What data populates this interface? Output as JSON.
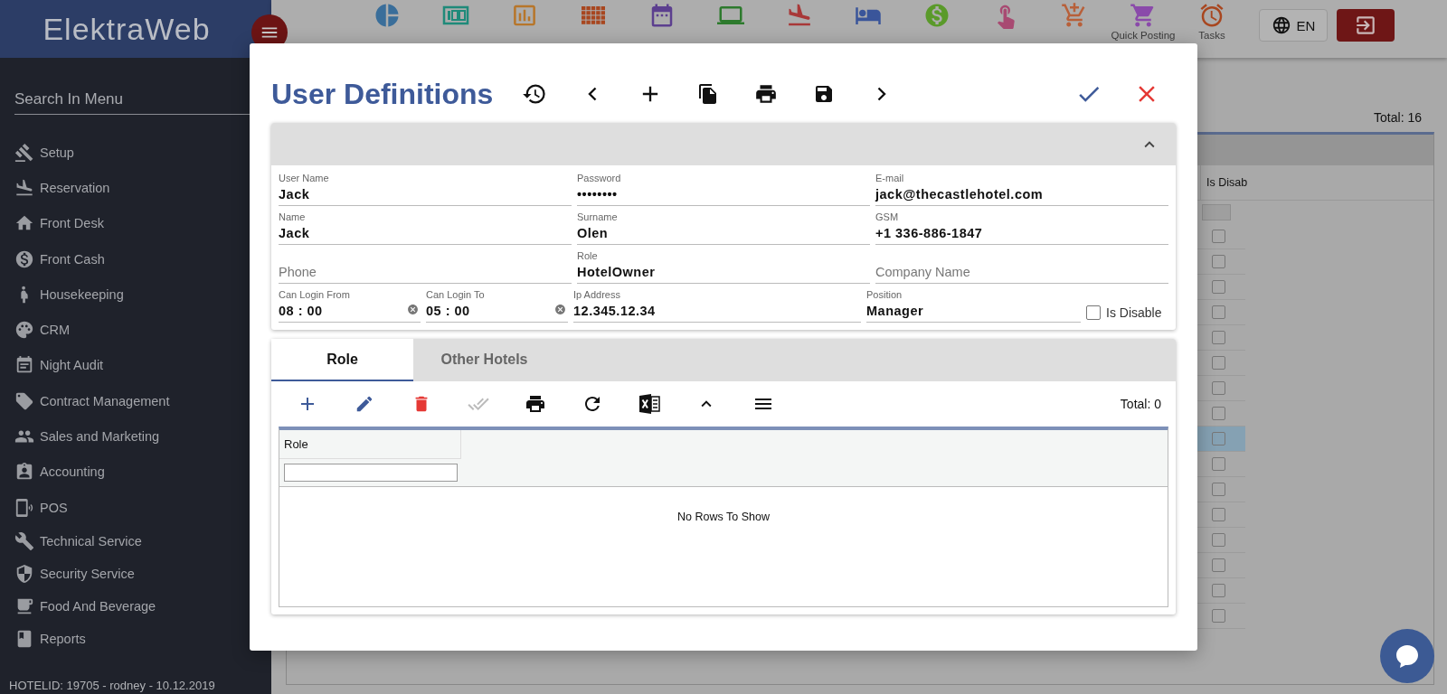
{
  "header": {
    "brand": "ElektraWeb",
    "toolbar": [
      {
        "kind": "pie",
        "color": "#3a6e9a"
      },
      {
        "kind": "hundred",
        "color": "#1f8a7a"
      },
      {
        "kind": "chart",
        "color": "#b7762a"
      },
      {
        "kind": "rack",
        "color": "#a8461f"
      },
      {
        "kind": "calendar",
        "color": "#5c3f8f"
      },
      {
        "kind": "laptop",
        "color": "#2d7a2d"
      },
      {
        "kind": "landing",
        "color": "#a83838"
      },
      {
        "kind": "bed",
        "color": "#3a559a"
      },
      {
        "kind": "cash",
        "color": "#5a9a2a"
      },
      {
        "kind": "touch",
        "color": "#a84a72"
      },
      {
        "kind": "cart-plus",
        "color": "#b8603a"
      },
      {
        "kind": "cart",
        "label": "Quick Posting",
        "color": "#8a4aaa"
      },
      {
        "kind": "alarm",
        "label": "Tasks",
        "color": "#a8461f"
      }
    ],
    "language": "EN"
  },
  "sidebar": {
    "search": {
      "placeholder": "Search In Menu"
    },
    "items": [
      {
        "kind": "gavel",
        "label": "Setup"
      },
      {
        "kind": "landing",
        "label": "Reservation"
      },
      {
        "kind": "home",
        "label": "Front Desk"
      },
      {
        "kind": "cash",
        "label": "Front Cash"
      },
      {
        "kind": "person",
        "label": "Housekeeping"
      },
      {
        "kind": "palette",
        "label": "CRM"
      },
      {
        "kind": "calendar",
        "label": "Night Audit"
      },
      {
        "kind": "tag",
        "label": "Contract Management"
      },
      {
        "kind": "people",
        "label": "Sales and Marketing"
      },
      {
        "kind": "badge",
        "label": "Accounting"
      },
      {
        "kind": "phone",
        "label": "POS"
      },
      {
        "kind": "wrench",
        "label": "Technical Service"
      },
      {
        "kind": "shield",
        "label": "Security Service"
      },
      {
        "kind": "cup",
        "label": "Food And Beverage"
      },
      {
        "kind": "book",
        "label": "Reports"
      }
    ],
    "footer": "HOTELID: 19705 - rodney - 10.12.2019"
  },
  "background_table": {
    "total": "Total: 16",
    "column": "Is Disab",
    "rows": [
      {
        "selected": false,
        "checked": false
      },
      {
        "selected": false,
        "checked": false
      },
      {
        "selected": false,
        "checked": false
      },
      {
        "selected": false,
        "checked": false
      },
      {
        "selected": false,
        "checked": false
      },
      {
        "selected": false,
        "checked": false
      },
      {
        "selected": false,
        "checked": false
      },
      {
        "selected": false,
        "checked": false
      },
      {
        "selected": true,
        "checked": false
      },
      {
        "selected": false,
        "checked": false
      },
      {
        "selected": false,
        "checked": false
      },
      {
        "selected": false,
        "checked": false
      },
      {
        "selected": false,
        "checked": false
      },
      {
        "selected": false,
        "checked": false
      },
      {
        "selected": false,
        "checked": false
      },
      {
        "selected": false,
        "checked": false
      }
    ]
  },
  "dialog": {
    "title": "User Definitions",
    "form_rows": [
      {
        "kind": "triple",
        "fields": [
          {
            "kind": "text",
            "label": "User Name",
            "value": "Jack"
          },
          {
            "kind": "text",
            "label": "Password",
            "value": "••••••••"
          },
          {
            "kind": "text",
            "label": "E-mail",
            "value": "jack@thecastlehotel.com"
          }
        ]
      },
      {
        "kind": "triple",
        "fields": [
          {
            "kind": "text",
            "label": "Name",
            "value": "Jack"
          },
          {
            "kind": "text",
            "label": "Surname",
            "value": "Olen"
          },
          {
            "kind": "text",
            "label": "GSM",
            "value": "+1 336-886-1847"
          }
        ]
      },
      {
        "kind": "triple",
        "fields": [
          {
            "kind": "text",
            "placeholder": "Phone"
          },
          {
            "kind": "text",
            "label": "Role",
            "value": "HotelOwner"
          },
          {
            "kind": "text",
            "placeholder": "Company Name"
          }
        ]
      },
      {
        "kind": "split",
        "fields": [
          {
            "kind": "time",
            "label": "Can Login From",
            "value": "08 : 00"
          },
          {
            "kind": "time",
            "label": "Can Login To",
            "value": "05 : 00"
          },
          {
            "kind": "text",
            "label": "Ip Address",
            "value": "12.345.12.34"
          },
          {
            "kind": "text",
            "label": "Position",
            "value": "Manager"
          },
          {
            "kind": "checkbox",
            "label": "Is Disable",
            "checked": false
          }
        ]
      }
    ],
    "tabs": [
      {
        "label": "Role",
        "selected": true
      },
      {
        "label": "Other Hotels",
        "selected": false
      }
    ],
    "grid": {
      "total": "Total: 0",
      "columns": [
        "Role"
      ],
      "empty": "No Rows To Show"
    }
  }
}
